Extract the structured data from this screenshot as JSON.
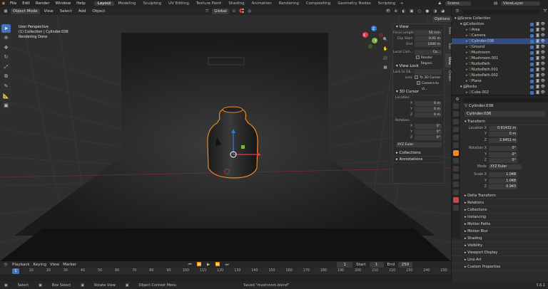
{
  "menu": [
    "File",
    "Edit",
    "Render",
    "Window",
    "Help"
  ],
  "workspaces": [
    "Layout",
    "Modeling",
    "Sculpting",
    "UV Editing",
    "Texture Paint",
    "Shading",
    "Animation",
    "Rendering",
    "Compositing",
    "Geometry Nodes",
    "Scripting"
  ],
  "active_workspace": "Layout",
  "scene": "Scene",
  "view_layer": "ViewLayer",
  "viewport_header": {
    "mode": "Object Mode",
    "menus": [
      "View",
      "Select",
      "Add",
      "Object"
    ],
    "orientation": "Global",
    "options": "Options"
  },
  "viewport_overlay": {
    "line1": "User Perspective",
    "line2": "(1) Collection | Cylinder.036",
    "line3": "Rendering Done"
  },
  "npanel": {
    "view_title": "View",
    "focal_label": "Focal Length",
    "focal_value": "50 mm",
    "clip_start_label": "Clip Start",
    "clip_start_value": "0.01 m",
    "end_label": "End",
    "end_value": "1000 m",
    "local_camera_label": "Local Cam...",
    "local_camera_value": "Ca...",
    "render_region": "Render Region",
    "view_lock_title": "View Lock",
    "lock_to_obj": "Lock to Ob...",
    "lock_label": "Lock",
    "to_3d_cursor": "To 3D Cursor",
    "camera_to_view": "Camera to Vi...",
    "cursor_title": "3D Cursor",
    "location_label": "Location:",
    "x": "X",
    "y": "Y",
    "z": "Z",
    "loc_x": "0 m",
    "loc_y": "0 m",
    "loc_z": "0 m",
    "rotation_label": "Rotation:",
    "rot_x": "0°",
    "rot_y": "0°",
    "rot_z": "0°",
    "rot_mode": "XYZ Euler",
    "collections": "Collections",
    "annotations": "Annotations",
    "tabs": [
      "Item",
      "Tool",
      "View",
      "Create"
    ]
  },
  "timeline": {
    "menus": [
      "Playback",
      "Keying",
      "View",
      "Marker"
    ],
    "current": "1",
    "start_label": "Start",
    "start": "1",
    "end_label": "End",
    "end": "250",
    "ticks": [
      "1",
      "10",
      "20",
      "30",
      "40",
      "50",
      "60",
      "70",
      "80",
      "90",
      "100",
      "110",
      "120",
      "130",
      "140",
      "150",
      "160",
      "170",
      "180",
      "190",
      "200",
      "210",
      "220",
      "230",
      "240",
      "250"
    ]
  },
  "status": {
    "select": "Select",
    "box_select": "Box Select",
    "rotate_view": "Rotate View",
    "context_menu": "Object Context Menu",
    "saved": "Saved \"mushroom.blend\"",
    "version": "3.6.1"
  },
  "outliner": {
    "rows": [
      {
        "name": "Scene Collection",
        "indent": 0,
        "sel": false
      },
      {
        "name": "Collection",
        "indent": 1,
        "sel": false
      },
      {
        "name": "Area",
        "indent": 2,
        "sel": false
      },
      {
        "name": "Camera",
        "indent": 2,
        "sel": false
      },
      {
        "name": "Cylinder.036",
        "indent": 2,
        "sel": true
      },
      {
        "name": "Ground",
        "indent": 2,
        "sel": false
      },
      {
        "name": "Mushroom",
        "indent": 2,
        "sel": false
      },
      {
        "name": "Mushroom.001",
        "indent": 2,
        "sel": false
      },
      {
        "name": "NurbsPath",
        "indent": 2,
        "sel": false
      },
      {
        "name": "NurbsPath.001",
        "indent": 2,
        "sel": false
      },
      {
        "name": "NurbsPath.002",
        "indent": 2,
        "sel": false
      },
      {
        "name": "Plane",
        "indent": 2,
        "sel": false
      },
      {
        "name": "Rocks",
        "indent": 1,
        "sel": false
      },
      {
        "name": "Cube.002",
        "indent": 2,
        "sel": false
      }
    ]
  },
  "properties": {
    "object_name": "Cylinder.036",
    "object_field": "Cylinder.036",
    "transform": "Transform",
    "location_x_label": "Location X",
    "location_x": "0.91432 m",
    "y_label": "Y",
    "location_y": "0 m",
    "z_label": "Z",
    "location_z": "2.6451 m",
    "rotation_x_label": "Rotation X",
    "rotation_x": "0°",
    "rotation_y": "0°",
    "rotation_z": "0°",
    "mode_label": "Mode",
    "mode": "XYZ Euler",
    "scale_x_label": "Scale X",
    "scale_x": "1.048",
    "scale_y": "1.048",
    "scale_z": "0.943",
    "sections": [
      "Delta Transform",
      "Relations",
      "Collections",
      "Instancing",
      "Motion Paths",
      "Motion Blur",
      "Shading",
      "Visibility",
      "Viewport Display",
      "Line Art",
      "Custom Properties"
    ]
  },
  "colors": {
    "accent": "#4772b3",
    "orange": "#f08a24",
    "x_axis": "#e33c4f",
    "y_axis": "#7cb342",
    "z_axis": "#2f7cd8"
  }
}
